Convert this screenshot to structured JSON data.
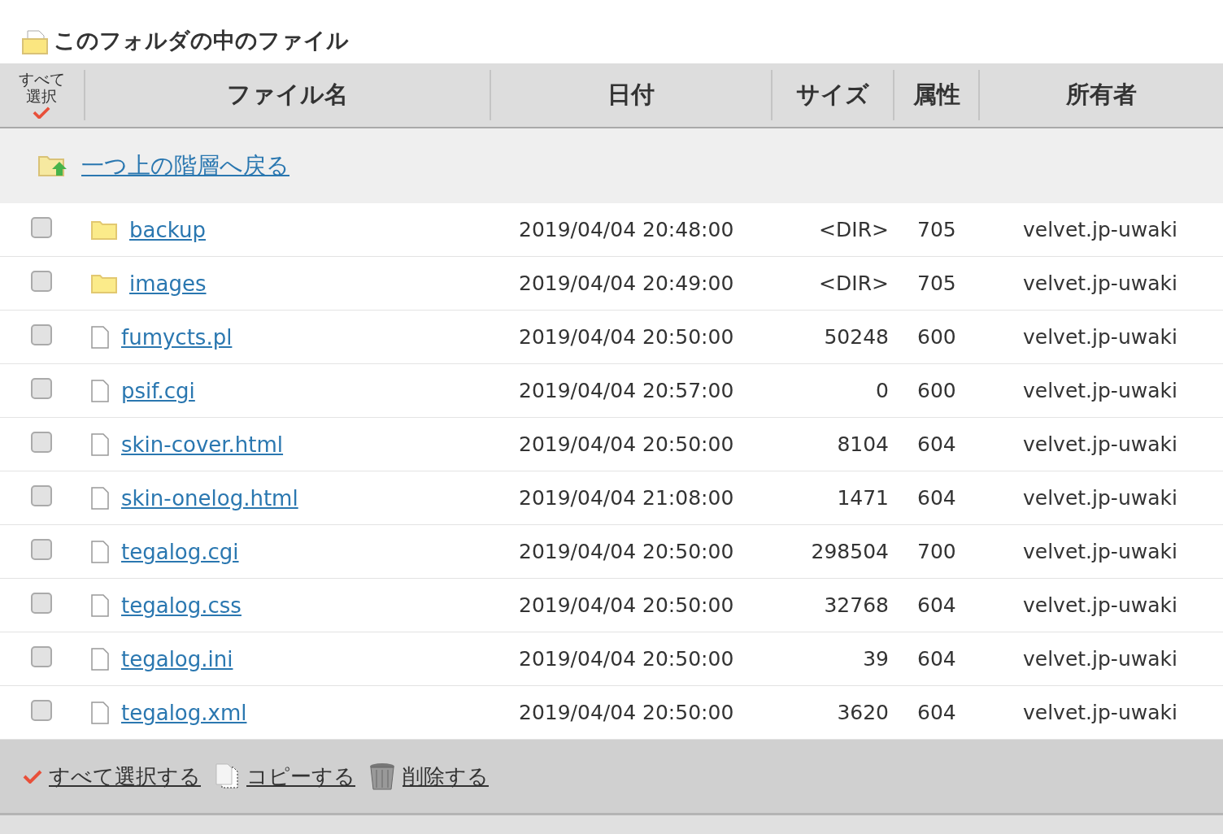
{
  "title": "このフォルダの中のファイル",
  "table": {
    "columns": [
      {
        "kind": "select",
        "label": "すべて選択"
      },
      {
        "kind": "text",
        "label": "ファイル名"
      },
      {
        "kind": "text",
        "label": "日付"
      },
      {
        "kind": "text",
        "label": "サイズ"
      },
      {
        "kind": "text",
        "label": "属性"
      },
      {
        "kind": "text",
        "label": "所有者"
      }
    ],
    "parent_link": "一つ上の階層へ戻る",
    "rows": [
      {
        "kind": "folder",
        "checked": false,
        "name": "backup",
        "date": "2019/04/04 20:48:00",
        "size": "<DIR>",
        "attr": "705",
        "owner": "velvet.jp-uwaki"
      },
      {
        "kind": "folder",
        "checked": false,
        "name": "images",
        "date": "2019/04/04 20:49:00",
        "size": "<DIR>",
        "attr": "705",
        "owner": "velvet.jp-uwaki"
      },
      {
        "kind": "file",
        "checked": false,
        "name": "fumycts.pl",
        "date": "2019/04/04 20:50:00",
        "size": "50248",
        "attr": "600",
        "owner": "velvet.jp-uwaki"
      },
      {
        "kind": "file",
        "checked": false,
        "name": "psif.cgi",
        "date": "2019/04/04 20:57:00",
        "size": "0",
        "attr": "600",
        "owner": "velvet.jp-uwaki"
      },
      {
        "kind": "file",
        "checked": false,
        "name": "skin-cover.html",
        "date": "2019/04/04 20:50:00",
        "size": "8104",
        "attr": "604",
        "owner": "velvet.jp-uwaki"
      },
      {
        "kind": "file",
        "checked": false,
        "name": "skin-onelog.html",
        "date": "2019/04/04 21:08:00",
        "size": "1471",
        "attr": "604",
        "owner": "velvet.jp-uwaki"
      },
      {
        "kind": "file",
        "checked": false,
        "name": "tegalog.cgi",
        "date": "2019/04/04 20:50:00",
        "size": "298504",
        "attr": "700",
        "owner": "velvet.jp-uwaki"
      },
      {
        "kind": "file",
        "checked": false,
        "name": "tegalog.css",
        "date": "2019/04/04 20:50:00",
        "size": "32768",
        "attr": "604",
        "owner": "velvet.jp-uwaki"
      },
      {
        "kind": "file",
        "checked": false,
        "name": "tegalog.ini",
        "date": "2019/04/04 20:50:00",
        "size": "39",
        "attr": "604",
        "owner": "velvet.jp-uwaki"
      },
      {
        "kind": "file",
        "checked": false,
        "name": "tegalog.xml",
        "date": "2019/04/04 20:50:00",
        "size": "3620",
        "attr": "604",
        "owner": "velvet.jp-uwaki"
      }
    ]
  },
  "actions": [
    {
      "kind": "select",
      "label": "すべて選択する"
    },
    {
      "kind": "copy",
      "label": "コピーする"
    },
    {
      "kind": "delete",
      "label": "削除する"
    }
  ]
}
